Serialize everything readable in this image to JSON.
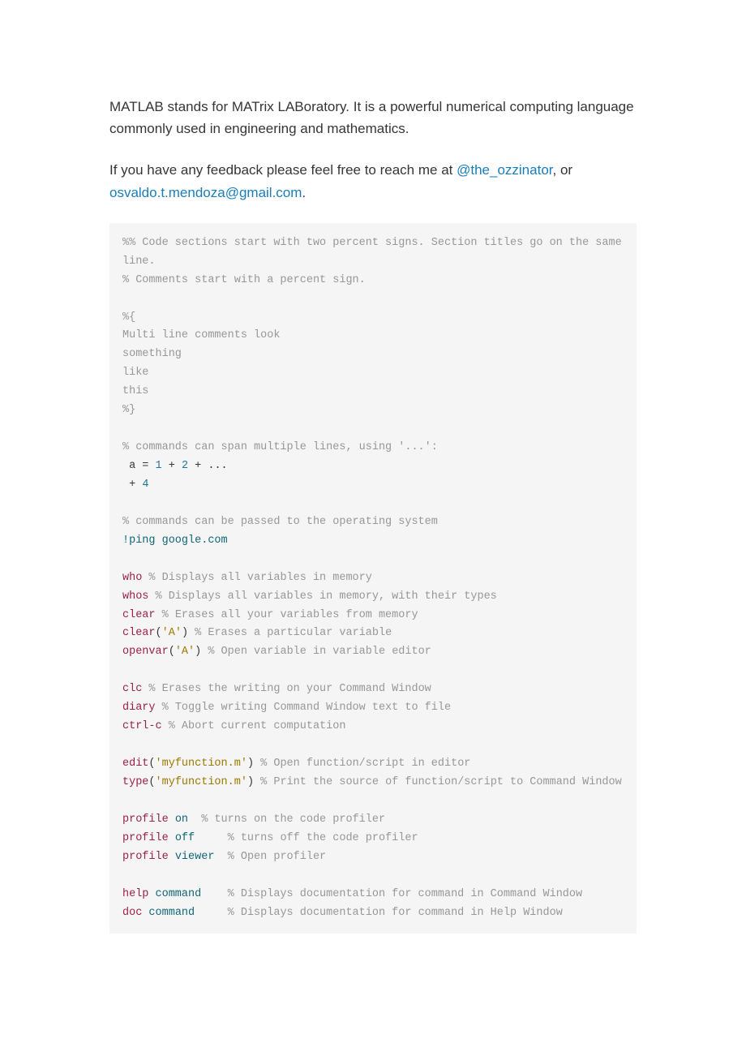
{
  "intro": {
    "p1": "MATLAB stands for MATrix LABoratory. It is a powerful numerical computing language commonly used in engineering and mathematics.",
    "p2_pre": "If you have any feedback please feel free to reach me at ",
    "link1": "@the_ozzinator",
    "p2_mid": ", or ",
    "link2": "osvaldo.t.mendoza@gmail.com",
    "p2_post": "."
  },
  "c": {
    "sec1": "%% Code sections start with two percent signs. Section titles go on the same line.",
    "sec2": "% Comments start with a percent sign.",
    "ml1": "%{",
    "ml2": "Multi line comments look",
    "ml3": "something",
    "ml4": "like",
    "ml5": "this",
    "ml6": "%}",
    "span_cmt": "% commands can span multiple lines, using '...':",
    "span_l1a": " a = ",
    "span_l1b": "1",
    "span_l1c": " + ",
    "span_l1d": "2",
    "span_l1e": " + ...",
    "span_l2a": " + ",
    "span_l2b": "4",
    "os_cmt": "% commands can be passed to the operating system",
    "os_cmd": "!ping google.com",
    "who": "who",
    "who_c": " % Displays all variables in memory",
    "whos": "whos",
    "whos_c": " % Displays all variables in memory, with their types",
    "clear": "clear",
    "clear_c": " % Erases all your variables from memory",
    "clearA": "clear",
    "clearA_p1": "(",
    "clearA_s": "'A'",
    "clearA_p2": ")",
    "clearA_c": " % Erases a particular variable",
    "openvar": "openvar",
    "openvar_p1": "(",
    "openvar_s": "'A'",
    "openvar_p2": ")",
    "openvar_c": " % Open variable in variable editor",
    "clc": "clc",
    "clc_c": " % Erases the writing on your Command Window",
    "diary": "diary",
    "diary_c": " % Toggle writing Command Window text to file",
    "ctrlc": "ctrl-c",
    "ctrlc_c": " % Abort current computation",
    "edit": "edit",
    "edit_p1": "(",
    "edit_s": "'myfunction.m'",
    "edit_p2": ")",
    "edit_c": " % Open function/script in editor",
    "type": "type",
    "type_p1": "(",
    "type_s": "'myfunction.m'",
    "type_p2": ")",
    "type_c": " % Print the source of function/script to Command Window",
    "prof1a": "profile",
    "prof1b": " on",
    "prof1c": "  % turns on the code profiler",
    "prof2a": "profile",
    "prof2b": " off",
    "prof2c": "     % turns off the code profiler",
    "prof3a": "profile",
    "prof3b": " viewer",
    "prof3c": "  % Open profiler",
    "help": "help",
    "help2": " command",
    "help_c": "    % Displays documentation for command in Command Window",
    "doc": "doc",
    "doc2": " command",
    "doc_c": "     % Displays documentation for command in Help Window"
  }
}
